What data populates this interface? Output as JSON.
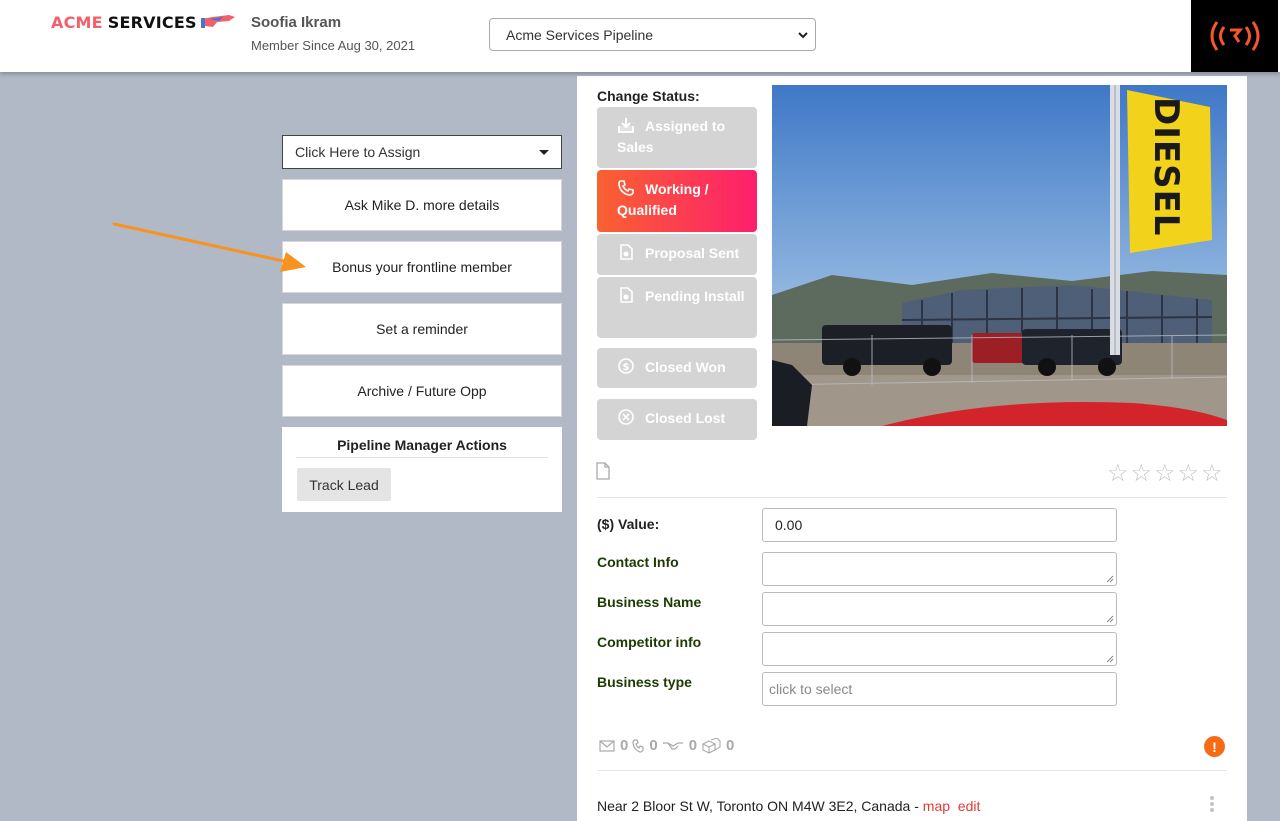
{
  "header": {
    "logo_word1": "ACME",
    "logo_word2": "SERVICES",
    "user_name": "Soofia Ikram",
    "member_since": "Member Since Aug 30, 2021",
    "pipeline_selected": "Acme Services Pipeline"
  },
  "actions": {
    "assign_dropdown": "Click Here to Assign",
    "buttons": [
      "Ask Mike D. more details",
      "Bonus your frontline member",
      "Set a reminder",
      "Archive / Future Opp"
    ],
    "pm_title": "Pipeline Manager Actions",
    "track_lead": "Track Lead"
  },
  "status": {
    "label": "Change Status:",
    "items": [
      {
        "label": "Assigned to Sales",
        "icon": "download-tray-icon",
        "active": false
      },
      {
        "label": "Working / Qualified",
        "icon": "phone-icon",
        "active": true
      },
      {
        "label": "Proposal Sent",
        "icon": "document-icon",
        "active": false
      },
      {
        "label": "Pending Install",
        "icon": "document-icon",
        "active": false
      },
      {
        "label": "Closed Won",
        "icon": "dollar-coin-icon",
        "active": false
      },
      {
        "label": "Closed Lost",
        "icon": "x-circle-icon",
        "active": false
      }
    ]
  },
  "photo": {
    "sign_text": "DIESEL"
  },
  "rating": {
    "stars_filled": 0,
    "stars_total": 5
  },
  "fields": {
    "value_label": "($) Value:",
    "value": "0.00",
    "contact_label": "Contact Info",
    "contact_value": "",
    "business_name_label": "Business Name",
    "business_name_value": "",
    "competitor_label": "Competitor info",
    "competitor_value": "",
    "business_type_label": "Business type",
    "business_type_placeholder": "click to select"
  },
  "counters": {
    "email": "0",
    "calls": "0",
    "handshake": "0",
    "packages": "0"
  },
  "address": {
    "text": "Near 2 Bloor St W, Toronto ON M4W 3E2, Canada - ",
    "map": "map",
    "edit": "edit"
  },
  "colors": {
    "accent_orange": "#f96230",
    "accent_pink": "#fe1e6d",
    "label_green": "#1b3b00",
    "link_red": "#e03b3b",
    "arrow_orange": "#f7931e"
  }
}
